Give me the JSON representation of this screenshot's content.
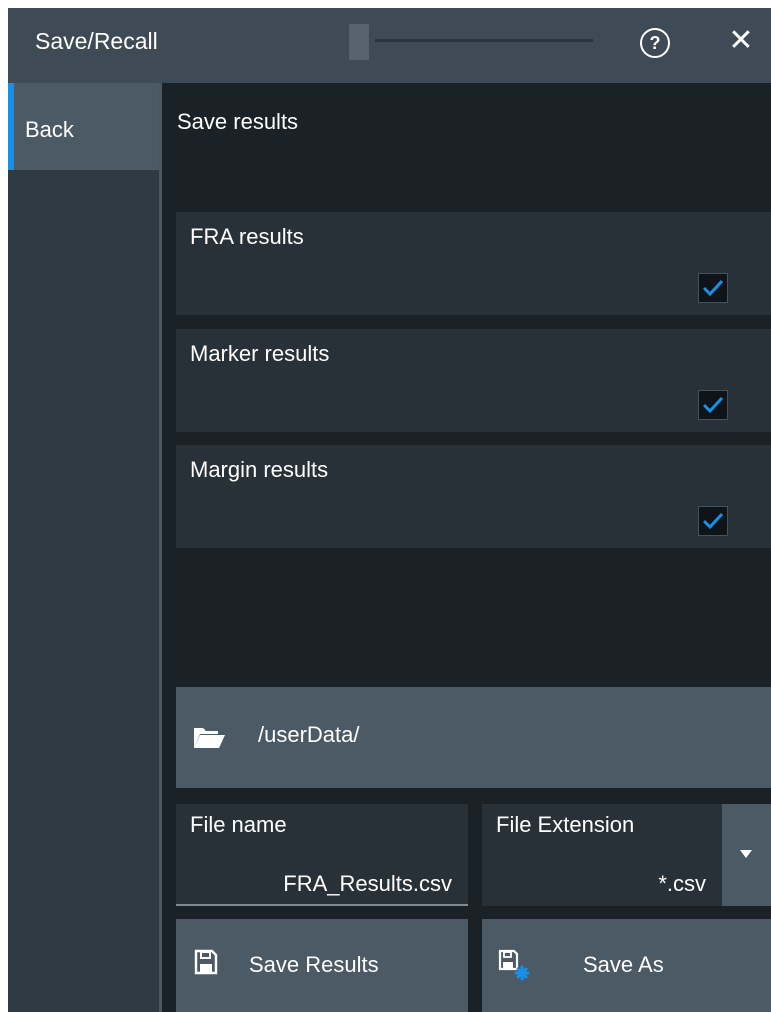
{
  "window": {
    "title": "Save/Recall",
    "help_symbol": "?",
    "close_symbol": "✕"
  },
  "sidebar": {
    "back_label": "Back"
  },
  "main": {
    "section_title": "Save results",
    "options": [
      {
        "label": "FRA results",
        "checked": true
      },
      {
        "label": "Marker results",
        "checked": true
      },
      {
        "label": "Margin results",
        "checked": true
      }
    ],
    "path": {
      "icon": "folder-open-icon",
      "value": "/userData/"
    },
    "file_name": {
      "label": "File name",
      "value": "FRA_Results.csv"
    },
    "file_extension": {
      "label": "File Extension",
      "value": "*.csv"
    },
    "buttons": {
      "save_results": {
        "label": "Save Results",
        "icon": "floppy-disk-icon"
      },
      "save_as": {
        "label": "Save As",
        "icon": "floppy-disk-star-icon"
      }
    }
  },
  "colors": {
    "accent": "#1790e8",
    "background": "#1a2228",
    "panel": "#283138",
    "button": "#4b5a65"
  }
}
